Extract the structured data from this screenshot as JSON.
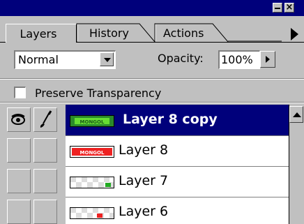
{
  "tabs": [
    {
      "label": "Layers"
    },
    {
      "label": "History"
    },
    {
      "label": "Actions"
    }
  ],
  "blend_mode": {
    "value": "Normal"
  },
  "opacity": {
    "label": "Opacity:",
    "value": "100%"
  },
  "preserve_transparency": {
    "label": "Preserve Transparency",
    "checked": false
  },
  "layers": [
    {
      "name": "Layer 8 copy",
      "selected": true,
      "visible": true,
      "thumb_text": "MONGOL",
      "thumb_color": "#33cc33"
    },
    {
      "name": "Layer 8",
      "selected": false,
      "visible": false,
      "thumb_text": "MONGOL",
      "thumb_color": "#ee2222"
    },
    {
      "name": "Layer 7",
      "selected": false,
      "visible": false,
      "thumb_text": "",
      "thumb_color": "#22aa22"
    },
    {
      "name": "Layer 6",
      "selected": false,
      "visible": false,
      "thumb_text": "",
      "thumb_color": "#ee2222"
    }
  ],
  "colors": {
    "titlebar": "#00007b",
    "panel": "#c0c0c0",
    "selection": "#00007b"
  }
}
